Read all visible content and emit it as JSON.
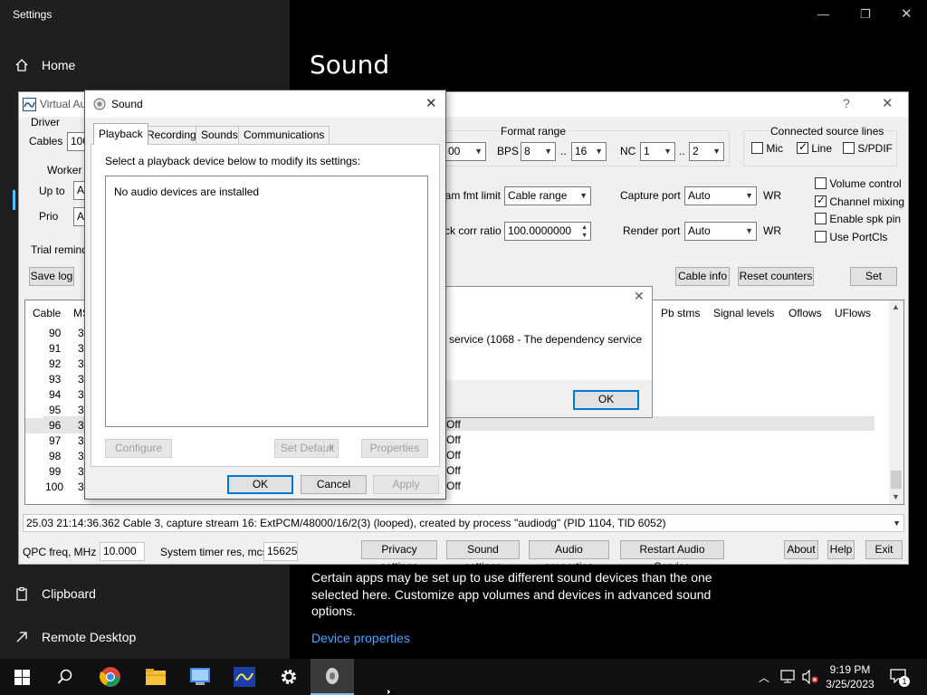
{
  "settings": {
    "window_title": "Settings",
    "nav": {
      "home": "Home",
      "clipboard": "Clipboard",
      "remote_desktop": "Remote Desktop"
    },
    "heading": "Sound",
    "description": "Certain apps may be set up to use different sound devices than the one selected here. Customize app volumes and devices in advanced sound options.",
    "device_properties_link": "Device properties"
  },
  "vac": {
    "title": "Virtual Au",
    "help_glyph": "?",
    "close_glyph": "✕",
    "driver_label": "Driver",
    "cables_label": "Cables",
    "cables_value": "100",
    "worker_label": "Worker t",
    "up_to_label": "Up to",
    "up_to_value": "A",
    "prio_label": "Prio",
    "prio_value": "A",
    "trial_reminder": "Trial reminde",
    "save_log": "Save log",
    "format_range_label": "Format range",
    "rate_value": "00",
    "bps_label": "BPS",
    "bps_min": "8",
    "bps_max": "16",
    "range_sep": "..",
    "nc_label": "NC",
    "nc_min": "1",
    "nc_max": "2",
    "connected_lines_label": "Connected source lines",
    "mic_label": "Mic",
    "line_label": "Line",
    "spdif_label": "S/PDIF",
    "stream_fmt_limit_label": "eam fmt limit",
    "stream_fmt_limit_value": "Cable range",
    "clock_corr_label": "ck corr ratio",
    "clock_corr_value": "100.0000000",
    "capture_port_label": "Capture port",
    "capture_port_value": "Auto",
    "render_port_label": "Render port",
    "render_port_value": "Auto",
    "wr_label": "WR",
    "volume_control": "Volume control",
    "channel_mixing": "Channel mixing",
    "enable_spk_pin": "Enable spk pin",
    "use_portcls": "Use PortCls",
    "cable_info": "Cable info",
    "reset_counters": "Reset counters",
    "set": "Set",
    "columns": {
      "cable": "Cable",
      "ms": "MS",
      "pb_stms": "Pb stms",
      "signal_levels": "Signal levels",
      "oflows": "Oflows",
      "uflows": "UFlows"
    },
    "rows": [
      {
        "cable": "90",
        "ms": "3"
      },
      {
        "cable": "91",
        "ms": "3"
      },
      {
        "cable": "92",
        "ms": "3"
      },
      {
        "cable": "93",
        "ms": "3"
      },
      {
        "cable": "94",
        "ms": "3"
      },
      {
        "cable": "95",
        "ms": "3"
      },
      {
        "cable": "96",
        "ms": "3"
      },
      {
        "cable": "97",
        "ms": "3"
      },
      {
        "cable": "98",
        "ms": "3"
      },
      {
        "cable": "99",
        "ms": "3"
      },
      {
        "cable": "100",
        "ms": "3"
      }
    ],
    "off_fragments": [
      "Off",
      "Off",
      "Off",
      "Off",
      "Off"
    ],
    "log_line": "25.03   21:14:36.362  Cable 3, capture stream 16: ExtPCM/48000/16/2(3) (looped), created by process \"audiodg\" (PID 1104, TID 6052)",
    "qpc_label": "QPC freq, MHz",
    "qpc_value": "10.000",
    "timer_label": "System timer res, mcs",
    "timer_value": "15625",
    "privacy_settings": "Privacy settings",
    "sound_settings": "Sound settings",
    "audio_properties": "Audio properties",
    "restart_audio_service": "Restart Audio Service",
    "about": "About",
    "help": "Help",
    "exit": "Exit"
  },
  "sound_dialog": {
    "title": "Sound",
    "tabs": [
      "Playback",
      "Recording",
      "Sounds",
      "Communications"
    ],
    "instruction": "Select a playback device below to modify its settings:",
    "empty_message": "No audio devices are installed",
    "configure": "Configure",
    "set_default": "Set Default",
    "properties": "Properties",
    "ok": "OK",
    "cancel": "Cancel",
    "apply": "Apply"
  },
  "error_dialog": {
    "message": "service (1068 - The dependency service",
    "ok": "OK"
  },
  "taskbar": {
    "time": "9:19 PM",
    "date": "3/25/2023",
    "notification_count": "1"
  }
}
